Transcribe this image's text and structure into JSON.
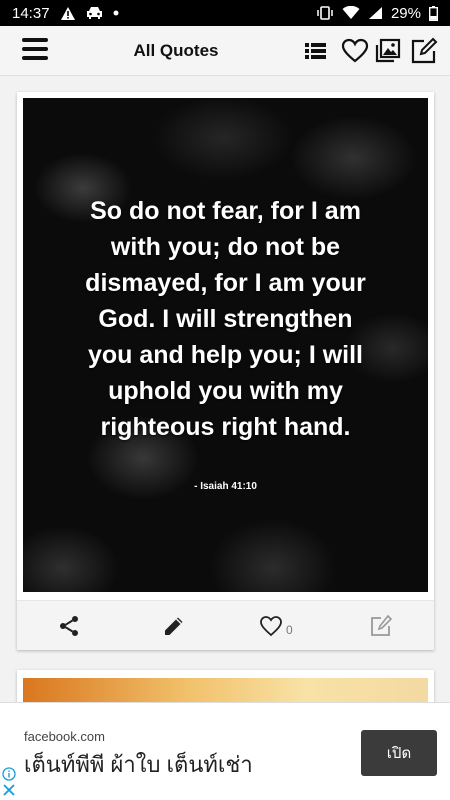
{
  "status_bar": {
    "time": "14:37",
    "battery": "29%"
  },
  "app_bar": {
    "title": "All Quotes",
    "icons": [
      "menu-icon",
      "list-icon",
      "heart-icon",
      "gallery-icon",
      "edit-icon"
    ]
  },
  "quote_card": {
    "text": "So do not fear, for I am with you; do not be dismayed, for I am your God. I will strengthen you and help you; I will uphold you with my righteous right hand.",
    "reference": "- Isaiah 41:10",
    "like_count": "0",
    "actions": [
      "share-icon",
      "pencil-icon",
      "heart-outline-icon",
      "edit-square-icon"
    ]
  },
  "ad": {
    "domain": "facebook.com",
    "headline": "เต็นท์พีพี ผ้าใบ เต็นท์เช่า",
    "button_label": "เปิด"
  }
}
